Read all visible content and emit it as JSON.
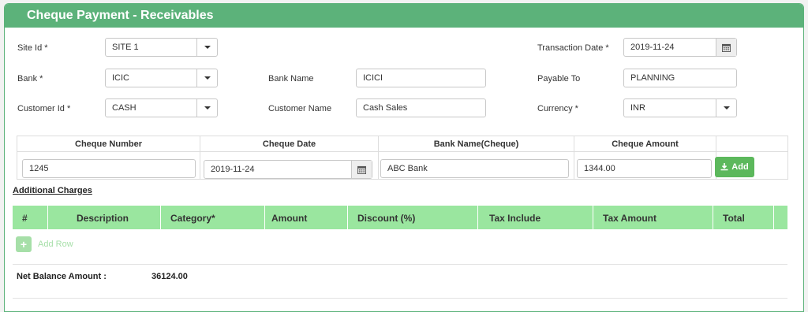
{
  "title": "Cheque Payment - Receivables",
  "fields": {
    "site_id": {
      "label": "Site Id *",
      "value": "SITE 1"
    },
    "transaction_date": {
      "label": "Transaction Date *",
      "value": "2019-11-24"
    },
    "bank": {
      "label": "Bank *",
      "value": "ICIC"
    },
    "bank_name": {
      "label": "Bank Name",
      "value": "ICICI"
    },
    "payable_to": {
      "label": "Payable To",
      "value": "PLANNING"
    },
    "customer_id": {
      "label": "Customer Id *",
      "value": "CASH"
    },
    "customer_name": {
      "label": "Customer Name",
      "value": "Cash Sales"
    },
    "currency": {
      "label": "Currency *",
      "value": "INR"
    }
  },
  "cheque": {
    "headers": [
      "Cheque Number",
      "Cheque Date",
      "Bank Name(Cheque)",
      "Cheque Amount"
    ],
    "number": "1245",
    "date": "2019-11-24",
    "bank_name": "ABC Bank",
    "amount": "1344.00",
    "add_label": "Add"
  },
  "additional_charges": {
    "title": "Additional Charges",
    "columns": [
      "#",
      "Description",
      "Category*",
      "Amount",
      "Discount (%)",
      "Tax Include",
      "Tax Amount",
      "Total"
    ],
    "add_row_label": "Add Row"
  },
  "net_balance": {
    "label": "Net Balance Amount :",
    "value": "36124.00"
  },
  "colors": {
    "header": "#5cb27a",
    "grid_header": "#9ae69f",
    "add_button": "#5cb85c"
  }
}
